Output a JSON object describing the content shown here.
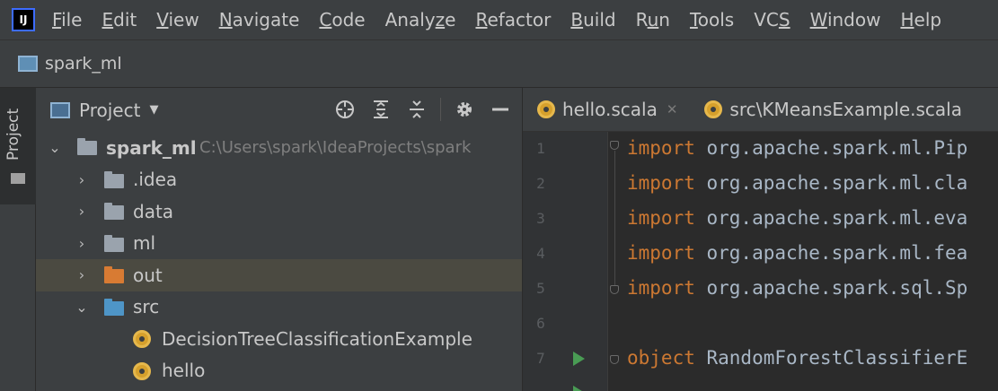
{
  "menubar": {
    "app_icon_text": "IJ",
    "items": [
      {
        "mnemonic": "F",
        "rest": "ile"
      },
      {
        "mnemonic": "E",
        "rest": "dit"
      },
      {
        "mnemonic": "V",
        "rest": "iew"
      },
      {
        "mnemonic": "N",
        "rest": "avigate"
      },
      {
        "mnemonic": "C",
        "rest": "ode"
      },
      {
        "pre": "Analy",
        "mnemonic": "z",
        "rest": "e"
      },
      {
        "mnemonic": "R",
        "rest": "efactor"
      },
      {
        "mnemonic": "B",
        "rest": "uild"
      },
      {
        "pre": "R",
        "mnemonic": "u",
        "rest": "n"
      },
      {
        "mnemonic": "T",
        "rest": "ools"
      },
      {
        "pre": "VC",
        "mnemonic": "S",
        "rest": ""
      },
      {
        "mnemonic": "W",
        "rest": "indow"
      },
      {
        "mnemonic": "H",
        "rest": "elp"
      }
    ]
  },
  "navbar": {
    "project_name": "spark_ml"
  },
  "side_strip": {
    "tab_label": "Project"
  },
  "project_panel": {
    "title": "Project",
    "tree": {
      "root": {
        "name": "spark_ml",
        "path": "C:\\Users\\spark\\IdeaProjects\\spark"
      },
      "idea": ".idea",
      "data": "data",
      "ml": "ml",
      "out": "out",
      "src": "src",
      "file1": "DecisionTreeClassificationExample",
      "file2": "hello"
    }
  },
  "editor": {
    "tabs": [
      "hello.scala",
      "src\\KMeansExample.scala"
    ],
    "lines": {
      "l1": {
        "num": "1",
        "kw": "import",
        "rest": " org.apache.spark.ml.Pip"
      },
      "l2": {
        "num": "2",
        "kw": "import",
        "rest": " org.apache.spark.ml.cla"
      },
      "l3": {
        "num": "3",
        "kw": "import",
        "rest": " org.apache.spark.ml.eva"
      },
      "l4": {
        "num": "4",
        "kw": "import",
        "rest": " org.apache.spark.ml.fea"
      },
      "l5": {
        "num": "5",
        "kw": "import",
        "rest": " org.apache.spark.sql.Sp"
      },
      "l6": {
        "num": "6"
      },
      "l7": {
        "num": "7",
        "kw": "object",
        "rest": " RandomForestClassifierE"
      }
    }
  },
  "colors": {
    "folder_gray": "#9aa3ad",
    "folder_excluded": "#d87b33",
    "folder_source": "#4e95c7",
    "scala_file": "#d6a02c",
    "keyword": "#cc7832",
    "run_arrow": "#499c54"
  }
}
